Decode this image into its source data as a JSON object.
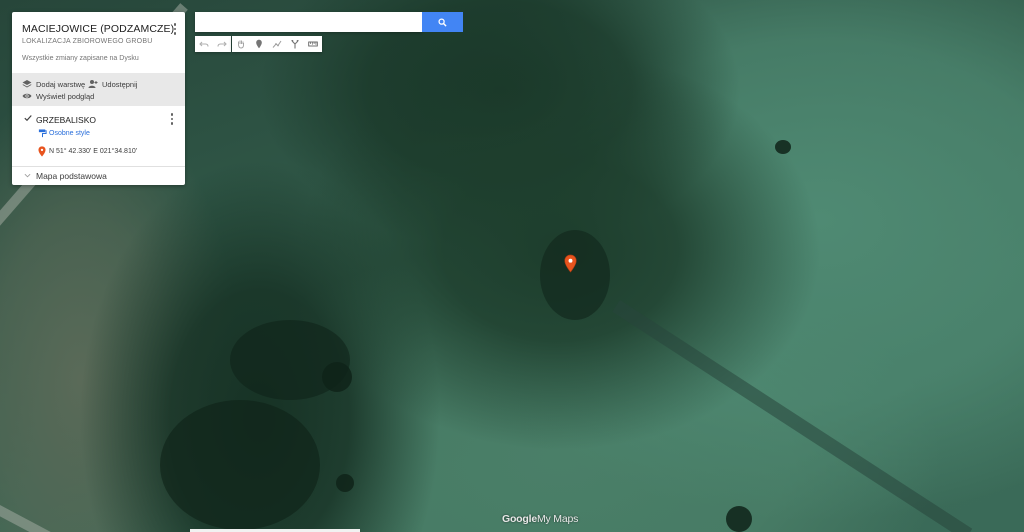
{
  "map_title": "MACIEJOWICE (PODZAMCZE)",
  "map_description": "LOKALIZACJA ZBIOROWEGO GROBU",
  "save_status": "Wszystkie zmiany zapisane na Dysku",
  "actions": {
    "add_layer": "Dodaj warstwę",
    "share": "Udostępnij",
    "preview": "Wyświetl podgląd"
  },
  "layer": {
    "name": "GRZEBALISKO",
    "checked": true,
    "style_link": "Osobne style",
    "point_coordinates": "N 51° 42.330' E 021°34.810'"
  },
  "base_map_label": "Mapa podstawowa",
  "search": {
    "placeholder": "",
    "value": ""
  },
  "toolbar": [
    {
      "name": "undo-icon"
    },
    {
      "name": "redo-icon"
    },
    {
      "name": "hand-icon"
    },
    {
      "name": "add-marker-icon"
    },
    {
      "name": "draw-line-icon"
    },
    {
      "name": "directions-icon"
    },
    {
      "name": "ruler-icon"
    }
  ],
  "branding": {
    "google": "Google",
    "product": "My Maps"
  },
  "colors": {
    "accent": "#4285f4",
    "marker": "#e8541e",
    "link": "#2a6fdb"
  }
}
